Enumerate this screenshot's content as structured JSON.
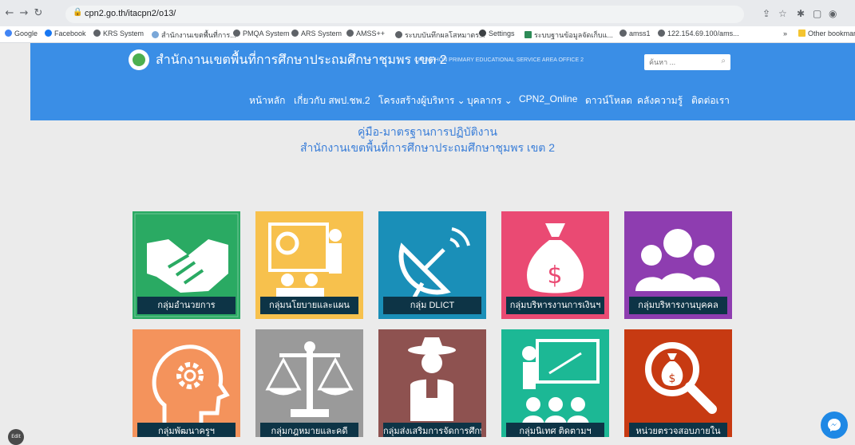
{
  "browser": {
    "url": "cpn2.go.th/itacpn2/o13/",
    "bookmarks": [
      {
        "label": "Google"
      },
      {
        "label": "Facebook"
      },
      {
        "label": "KRS System"
      },
      {
        "label": "สำนักงานเขตพื้นที่การ..."
      },
      {
        "label": "PMQA System"
      },
      {
        "label": "ARS System"
      },
      {
        "label": "AMSS++"
      },
      {
        "label": "ระบบบันทึกผลโสหมาตร..."
      },
      {
        "label": "Settings"
      },
      {
        "label": "ระบบฐานข้อมูลจัดเก็บแ..."
      },
      {
        "label": "amss1"
      },
      {
        "label": "122.154.69.100/ams..."
      },
      {
        "label": "»"
      },
      {
        "label": "Other bookmarks"
      }
    ]
  },
  "header": {
    "title": "สำนักงานเขตพื้นที่การศึกษาประถมศึกษาชุมพร เขต 2",
    "subtitle": "CHUMPHON PRIMARY EDUCATIONAL SERVICE AREA OFFICE 2",
    "search_placeholder": "ค้นหา ..."
  },
  "nav": [
    {
      "label": "หน้าหลัก"
    },
    {
      "label": "เกี่ยวกับ สพป.ชพ.2"
    },
    {
      "label": "โครงสร้างผู้บริหาร ⌄"
    },
    {
      "label": "บุคลากร ⌄"
    },
    {
      "label": "CPN2_Online"
    },
    {
      "label": "ดาวน์โหลด"
    },
    {
      "label": "คลังความรู้"
    },
    {
      "label": "ติดต่อเรา"
    }
  ],
  "page": {
    "heading_line1": "คู่มือ-มาตรฐานการปฏิบัติงาน",
    "heading_line2": "สำนักงานเขตพื้นที่การศึกษาประถมศึกษาชุมพร เขต 2"
  },
  "tiles": [
    {
      "label": "กลุ่มอำนวยการ",
      "color": "#2aaa63",
      "icon": "handshake-icon"
    },
    {
      "label": "กลุ่มนโยบายและแผน",
      "color": "#f7c14d",
      "icon": "presentation-icon"
    },
    {
      "label": "กลุ่ม DLICT",
      "color": "#1a8fb8",
      "icon": "satellite-dish-icon"
    },
    {
      "label": "กลุ่มบริหารงานการเงินฯ",
      "color": "#ea4a73",
      "icon": "money-bag-icon"
    },
    {
      "label": "กลุ่มบริหารงานบุคคล",
      "color": "#8e3db0",
      "icon": "people-icon"
    },
    {
      "label": "กลุ่มพัฒนาครูฯ",
      "color": "#f4935c",
      "icon": "head-gear-icon"
    },
    {
      "label": "กลุ่มกฎหมายและคดี",
      "color": "#9a9a9a",
      "icon": "scales-icon"
    },
    {
      "label": "กลุ่มส่งเสริมการจัดการศึกษา",
      "color": "#8e5250",
      "icon": "scout-icon"
    },
    {
      "label": "กลุ่มนิเทศ ติดตามฯ",
      "color": "#1cb895",
      "icon": "teacher-board-icon"
    },
    {
      "label": "หน่วยตรวจสอบภายใน",
      "color": "#c73a12",
      "icon": "magnifier-money-icon"
    }
  ],
  "edit_label": "Edit"
}
